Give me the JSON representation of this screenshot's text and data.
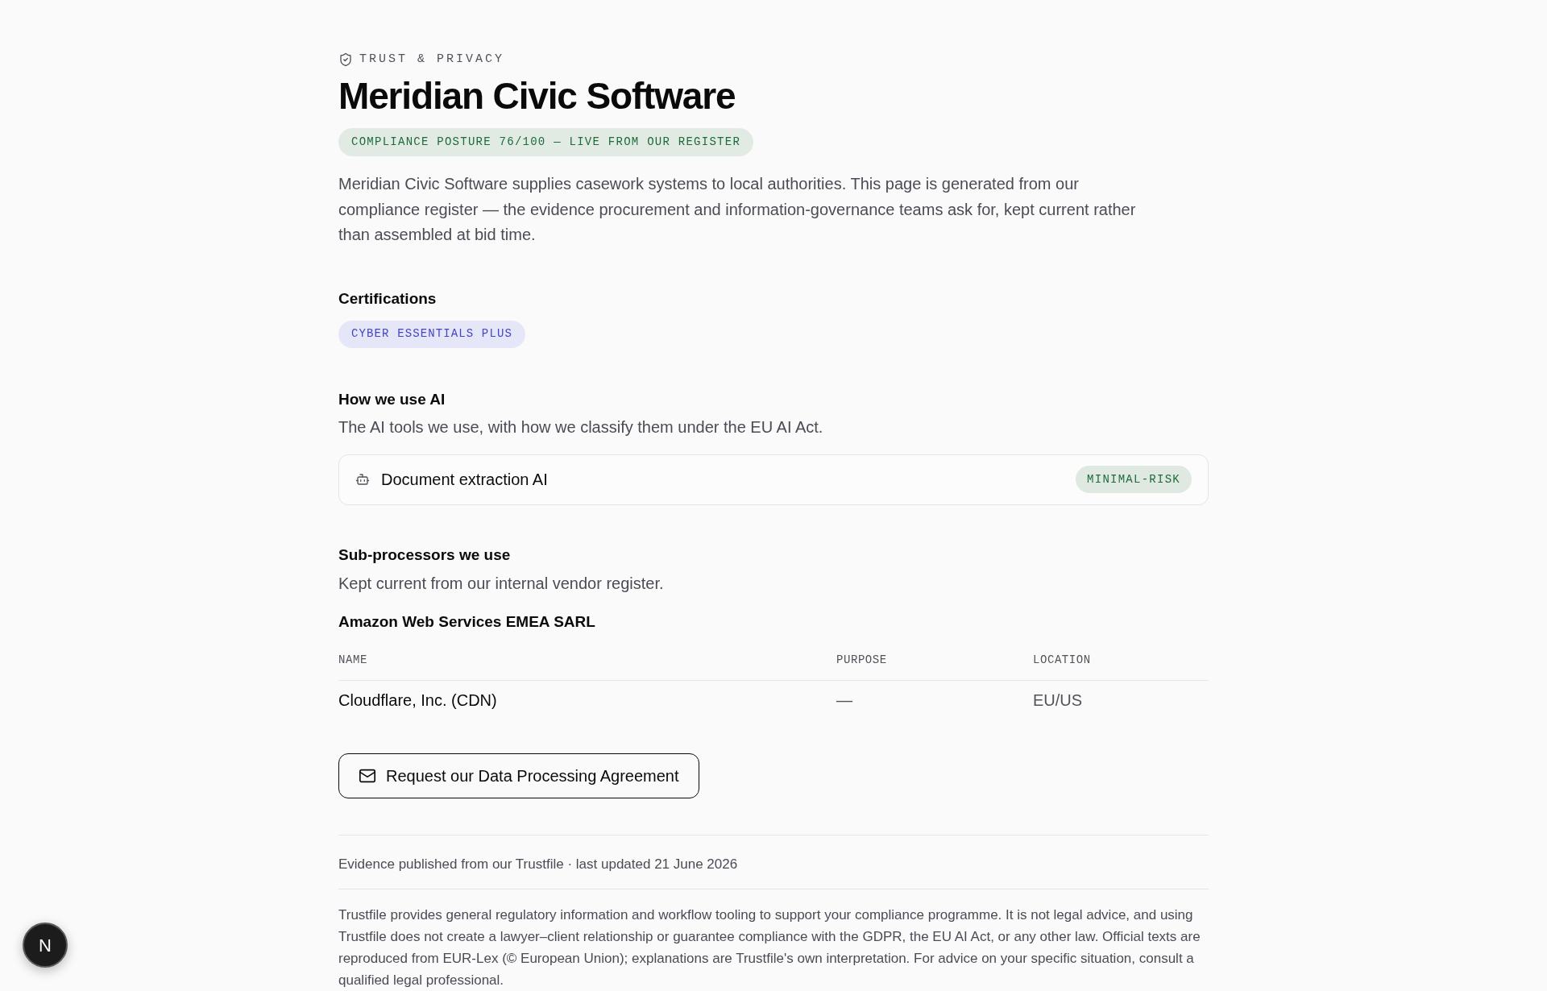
{
  "header": {
    "eyebrow": "TRUST & PRIVACY",
    "title": "Meridian Civic Software",
    "posture_badge": "COMPLIANCE POSTURE 76/100 — LIVE FROM OUR REGISTER",
    "intro": "Meridian Civic Software supplies casework systems to local authorities. This page is generated from our compliance register — the evidence procurement and information-governance teams ask for, kept current rather than assembled at bid time."
  },
  "certifications": {
    "heading": "Certifications",
    "items": [
      {
        "label": "CYBER ESSENTIALS PLUS"
      }
    ]
  },
  "ai_usage": {
    "heading": "How we use AI",
    "description": "The AI tools we use, with how we classify them under the EU AI Act.",
    "tools": [
      {
        "name": "Document extraction AI",
        "risk": "MINIMAL-RISK"
      }
    ]
  },
  "subprocessors": {
    "heading": "Sub-processors we use",
    "description": "Kept current from our internal vendor register.",
    "group_title": "Amazon Web Services EMEA SARL",
    "table": {
      "columns": [
        "NAME",
        "PURPOSE",
        "LOCATION"
      ],
      "rows": [
        [
          "Cloudflare, Inc. (CDN)",
          "—",
          "EU/US"
        ]
      ]
    }
  },
  "dpa_button": {
    "label": "Request our Data Processing Agreement"
  },
  "footer": {
    "published": "Evidence published from our Trustfile · last updated 21 June 2026",
    "disclaimer": "Trustfile provides general regulatory information and workflow tooling to support your compliance programme. It is not legal advice, and using Trustfile does not create a lawyer–client relationship or guarantee compliance with the GDPR, the EU AI Act, or any other law. Official texts are reproduced from EUR-Lex (© European Union); explanations are Trustfile's own interpretation. For advice on your specific situation, consult a qualified legal professional."
  },
  "dev_indicator": {
    "label": "N"
  }
}
